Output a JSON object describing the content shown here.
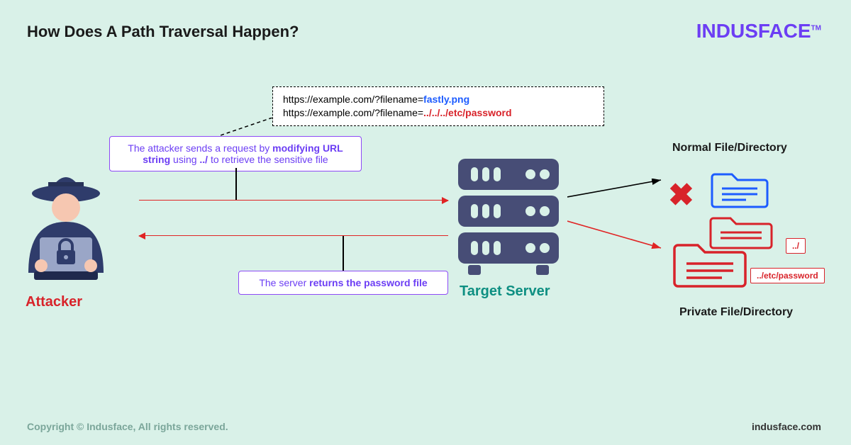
{
  "title": "How Does A Path Traversal Happen?",
  "brand": {
    "name": "INDUSFACE",
    "tm": "TM"
  },
  "attacker": {
    "label": "Attacker"
  },
  "server": {
    "label": "Target Server"
  },
  "url_box": {
    "prefix1": "https://example.com/?filename=",
    "val1": "fastly.png",
    "prefix2": "https://example.com/?filename=",
    "val2": "../../../etc/password"
  },
  "callouts": {
    "top_pre": "The attacker sends a request by ",
    "top_bold": "modifying URL string",
    "top_mid": " using ",
    "top_bold2": "../",
    "top_post": " to retrieve the sensitive file",
    "bottom_pre": "The server ",
    "bottom_bold": "returns the password file"
  },
  "files": {
    "normal_label": "Normal File/Directory",
    "private_label": "Private  File/Directory",
    "chip_dotslash": "../",
    "chip_etcpwd": "../etc/password"
  },
  "footer": {
    "copyright": "Copyright © Indusface, All rights reserved.",
    "site": "indusface.com"
  }
}
